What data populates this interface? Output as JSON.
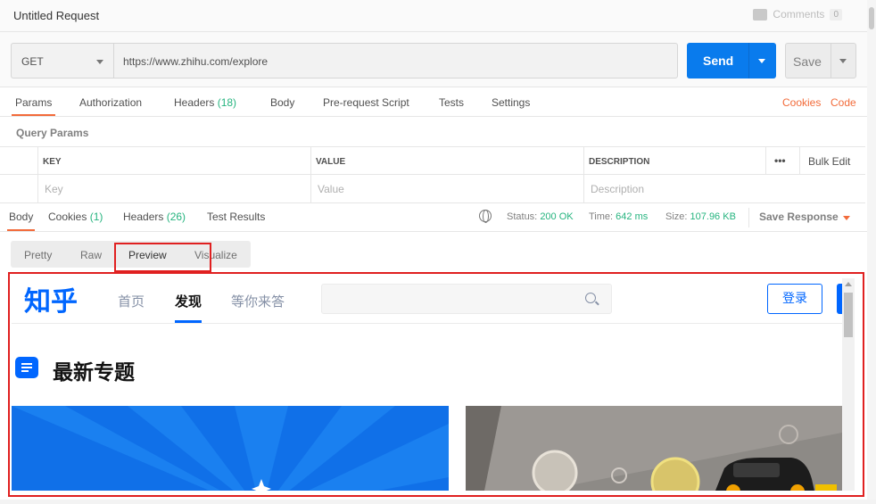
{
  "window": {
    "title": "Untitled Request",
    "comments_label": "Comments",
    "comments_count": "0"
  },
  "request": {
    "method": "GET",
    "url": "https://www.zhihu.com/explore",
    "send_label": "Send",
    "save_label": "Save"
  },
  "request_tabs": [
    {
      "label": "Params",
      "count": ""
    },
    {
      "label": "Authorization",
      "count": ""
    },
    {
      "label": "Headers",
      "count": "(18)"
    },
    {
      "label": "Body",
      "count": ""
    },
    {
      "label": "Pre-request Script",
      "count": ""
    },
    {
      "label": "Tests",
      "count": ""
    },
    {
      "label": "Settings",
      "count": ""
    }
  ],
  "links": {
    "cookies": "Cookies",
    "code": "Code"
  },
  "params": {
    "title": "Query Params",
    "headers": [
      "KEY",
      "VALUE",
      "DESCRIPTION"
    ],
    "placeholders": [
      "Key",
      "Value",
      "Description"
    ],
    "more": "•••",
    "bulk_edit": "Bulk Edit"
  },
  "response_tabs": [
    {
      "label": "Body",
      "count": ""
    },
    {
      "label": "Cookies",
      "count": "(1)"
    },
    {
      "label": "Headers",
      "count": "(26)"
    },
    {
      "label": "Test Results",
      "count": ""
    }
  ],
  "status": {
    "status_label": "Status:",
    "status_value": "200 OK",
    "time_label": "Time:",
    "time_value": "642 ms",
    "size_label": "Size:",
    "size_value": "107.96 KB",
    "save_response": "Save Response"
  },
  "view_tabs": [
    "Pretty",
    "Raw",
    "Preview",
    "Visualize"
  ],
  "preview": {
    "logo": "知乎",
    "nav": [
      "首页",
      "发现",
      "等你来答"
    ],
    "login": "登录",
    "section_title": "最新专题"
  },
  "colors": {
    "accent_orange": "#f26b3a",
    "send_blue": "#097bed",
    "status_green": "#26b47f",
    "zhihu_blue": "#0066ff",
    "highlight_red": "#e02020"
  }
}
